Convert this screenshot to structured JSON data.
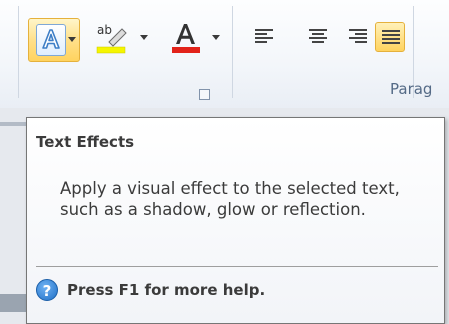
{
  "ribbon": {
    "buttons": [
      {
        "name": "text-effects",
        "icon": "text-effects-icon",
        "state": "hovered"
      },
      {
        "name": "text-highlight-color",
        "icon": "highlighter-icon",
        "color": "#f5f500"
      },
      {
        "name": "font-color",
        "icon": "font-color-icon",
        "color": "#e2231a"
      }
    ],
    "paragraph_group": {
      "label": "Parag",
      "align_buttons": [
        {
          "name": "align-left",
          "icon": "align-left-icon",
          "active": false
        },
        {
          "name": "align-center",
          "icon": "align-center-icon",
          "active": false
        },
        {
          "name": "align-right",
          "icon": "align-right-icon",
          "active": false
        },
        {
          "name": "justify",
          "icon": "justify-icon",
          "active": true
        }
      ]
    }
  },
  "tooltip": {
    "title": "Text Effects",
    "description": "Apply a visual effect to the selected text, such as a shadow, glow or reflection.",
    "help_icon": "help-icon",
    "help_text": "Press F1 for more help."
  },
  "colors": {
    "hover_accent": "#ffd35f",
    "help_blue": "#1f6fc6",
    "highlight_yellow": "#f5f500",
    "font_red": "#e2231a"
  }
}
